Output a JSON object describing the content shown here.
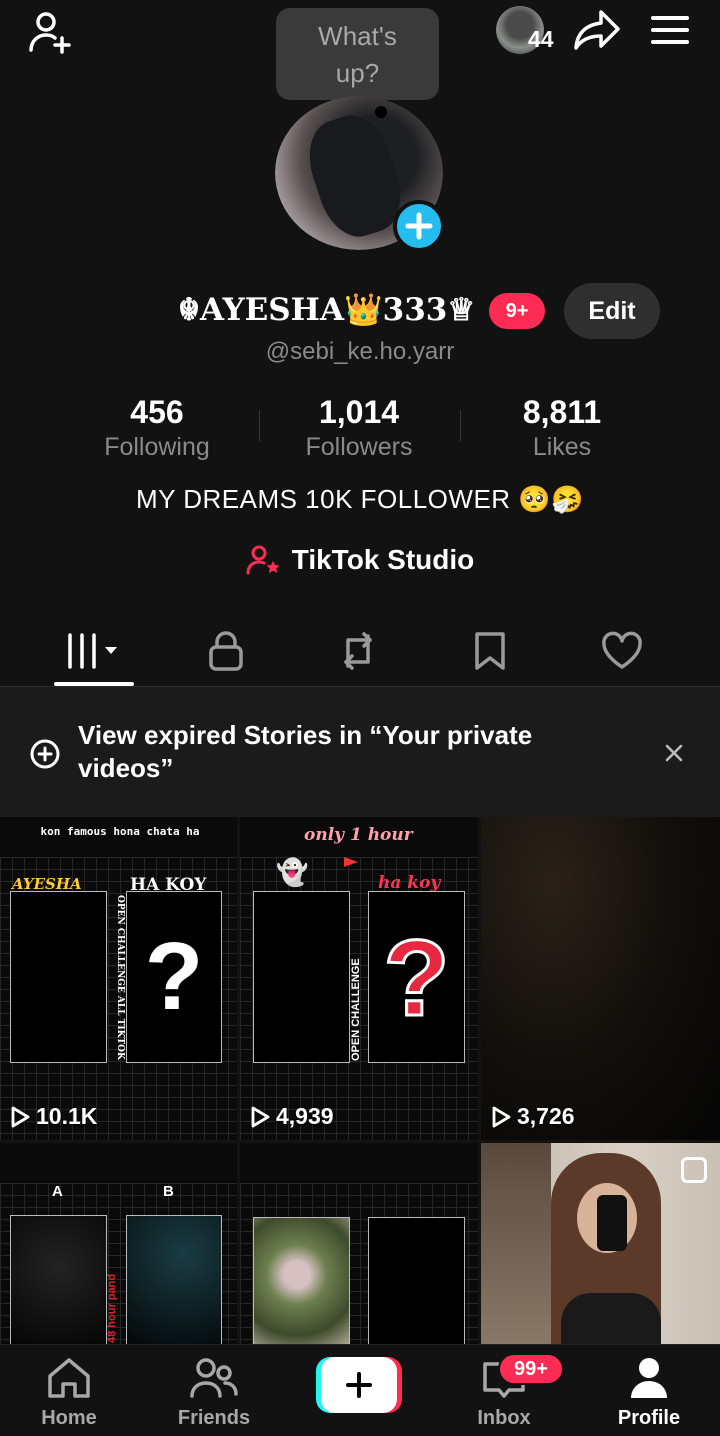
{
  "top_bar": {
    "add_friend_icon": "person-plus-icon",
    "status_bubble": "What's up?",
    "story_count": "44",
    "share_icon": "share-arrow-icon",
    "menu_icon": "hamburger-icon"
  },
  "profile": {
    "display_name": "☬AYESHA👑333♕",
    "notification_badge": "9+",
    "edit_label": "Edit",
    "handle": "@sebi_ke.ho.yarr",
    "bio": "MY DREAMS 10K FOLLOWER 🥺🤧",
    "studio_label": "TikTok Studio"
  },
  "stats": [
    {
      "value": "456",
      "label": "Following"
    },
    {
      "value": "1,014",
      "label": "Followers"
    },
    {
      "value": "8,811",
      "label": "Likes"
    }
  ],
  "tabs": [
    "videos-grid-icon",
    "lock-icon",
    "repost-icon",
    "bookmark-icon",
    "heart-icon"
  ],
  "banner": {
    "text": "View expired Stories in “Your private videos”",
    "close_icon": "close-icon"
  },
  "videos": [
    {
      "views": "10.1K",
      "caption_top": "kon famous hona chata ha",
      "left_label": "AYESHA",
      "right_label": "HA KOY",
      "side_text": "OPEN CHALLENGE ALL TIKTOK"
    },
    {
      "views": "4,939",
      "caption_top": "only 1 hour",
      "right_label": "ha koy",
      "side_text": "OPEN CHALLENGE"
    },
    {
      "views": "3,726"
    },
    {
      "label_a": "A",
      "label_b": "B",
      "side_text": "48 hour pand"
    },
    {},
    {}
  ],
  "nav": {
    "home": "Home",
    "friends": "Friends",
    "inbox": "Inbox",
    "inbox_badge": "99+",
    "profile": "Profile"
  },
  "colors": {
    "accent": "#fe2c55",
    "plus_blue": "#25bdf0",
    "background": "#121212"
  }
}
